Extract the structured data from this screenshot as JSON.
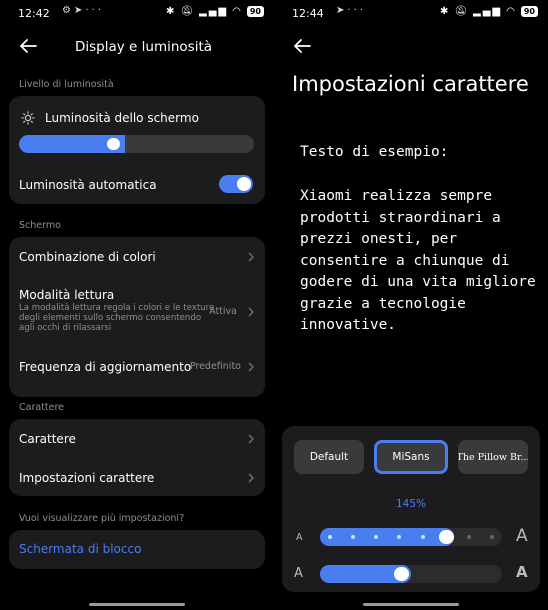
{
  "left": {
    "status": {
      "time": "12:42",
      "battery": "90"
    },
    "header": {
      "title": "Display e luminosità"
    },
    "sections": {
      "brightness_label": "Livello di luminosità",
      "screen_label": "Schermo",
      "font_label": "Carattere",
      "more_label": "Vuoi visualizzare più impostazioni?"
    },
    "brightness": {
      "label": "Luminosità dello schermo",
      "level": 0.45
    },
    "auto_brightness": {
      "label": "Luminosità automatica",
      "enabled": true
    },
    "screen_items": {
      "color_scheme": "Combinazione di colori",
      "reading_mode": {
        "label": "Modalità lettura",
        "desc": "La modalità lettura regola i colori e le texture degli elementi sullo schermo consentendo agli occhi di rilassarsi",
        "value": "Attiva"
      },
      "refresh_rate": {
        "label": "Frequenza di aggiornamento",
        "value": "Predefinito"
      }
    },
    "font_items": {
      "font": "Carattere",
      "font_settings": "Impostazioni carattere"
    },
    "lockscreen": "Schermata di blocco"
  },
  "right": {
    "status": {
      "time": "12:44",
      "battery": "90"
    },
    "title": "Impostazioni carattere",
    "sample_label": "Testo di esempio:",
    "sample_text": "Xiaomi realizza sempre prodotti straordinari a prezzi onesti, per consentire a chiunque di godere di una vita migliore grazie a tecnologie innovative.",
    "fonts": [
      "Default",
      "MiSans",
      "The Pillow Br..."
    ],
    "selected_font": "MiSans",
    "zoom": "145%",
    "size_slider": {
      "small_label": "A",
      "large_label": "A",
      "steps": 8,
      "current_step": 5
    },
    "weight_slider": {
      "small_label": "A",
      "large_label": "A",
      "level": 0.5
    }
  },
  "colors": {
    "accent": "#4a7df0",
    "card": "#1c1c1e",
    "background": "#000000"
  }
}
